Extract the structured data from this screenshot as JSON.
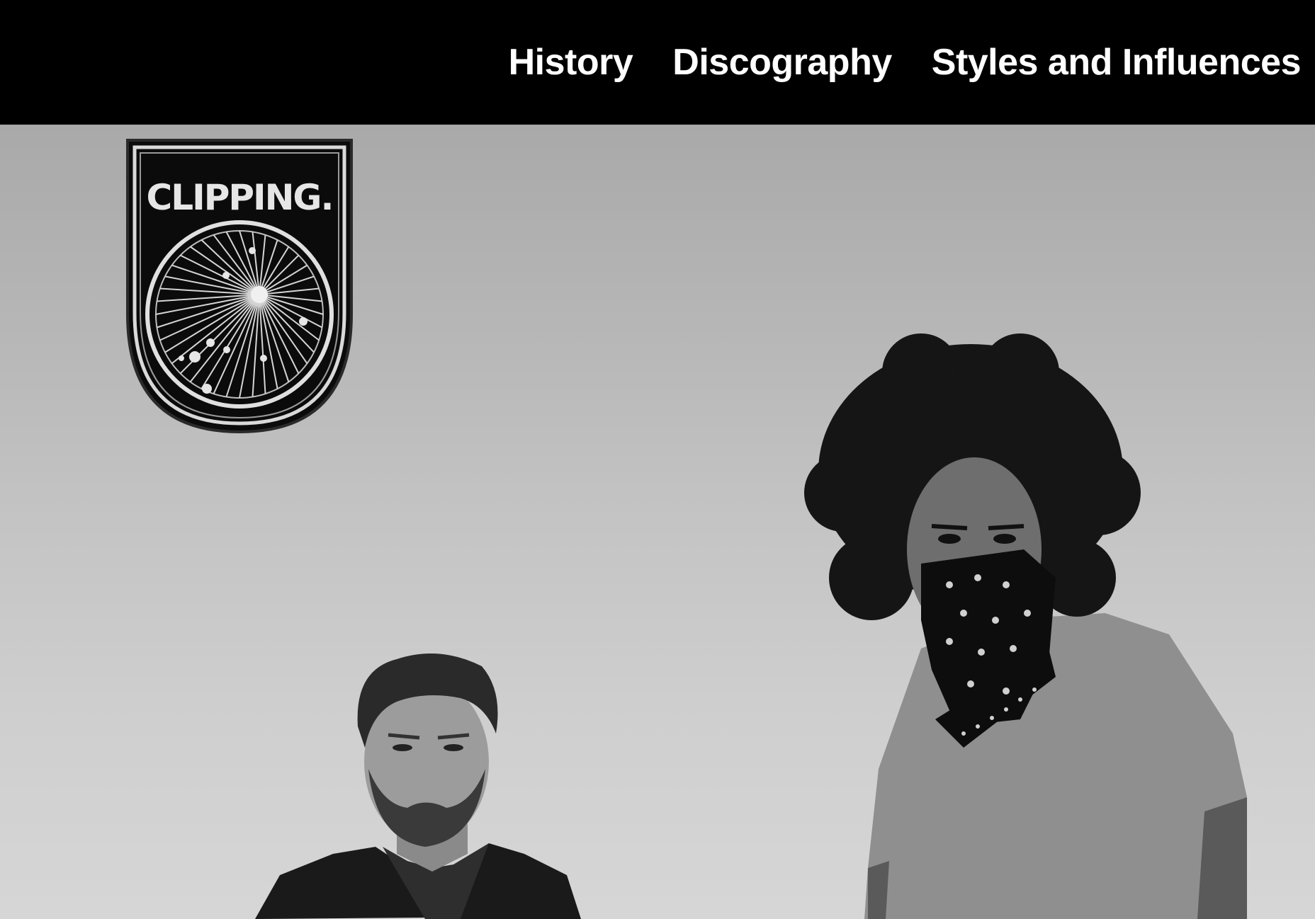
{
  "nav": {
    "items": [
      {
        "label": "History"
      },
      {
        "label": "Discography"
      },
      {
        "label": "Styles and Influences"
      }
    ]
  },
  "logo": {
    "text": "CLIPPING."
  },
  "hero": {
    "description_colors": {
      "sky_top": "#a9a9a9",
      "sky_bottom": "#d6d6d6"
    }
  }
}
